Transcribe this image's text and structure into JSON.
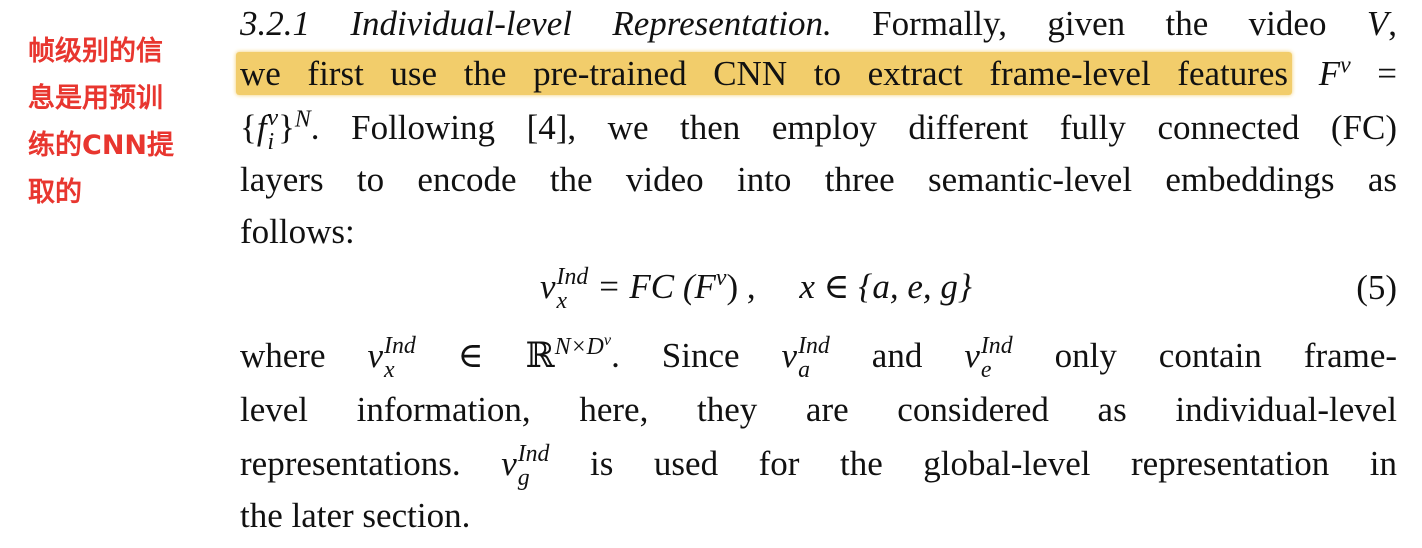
{
  "annotation": {
    "color": "#e8362f",
    "lines": [
      "帧级别的信",
      "息是用预训",
      "练的CNN提",
      "取的"
    ]
  },
  "highlight_color": "#f2cd6b",
  "section": {
    "number": "3.2.1",
    "title": "Individual-level Representation.",
    "line1_rest": "Formally, given the video",
    "video_sym": "V",
    "highlighted": "we first use the pre-trained CNN to extract frame-level features",
    "line2_rest": "= ",
    "F": "F",
    "v": "v",
    "f": "f",
    "i": "i",
    "N": "N",
    "line3_rest": ". Following [4], we then employ different fully connected (FC)",
    "line4": "layers to encode the video into three semantic-level embeddings as",
    "line5": "follows:",
    "equation": {
      "lhs_base": "v",
      "sup": "Ind",
      "sub_x": "x",
      "rhs": " = FC (F",
      "rhs_close": ") ,",
      "set": "x ∈ {a, e, g}",
      "number": "(5)"
    },
    "line7_a": "where",
    "line7_b": "∈ ℝ",
    "line7_sup": "N×D",
    "line7_c": ". Since",
    "line7_d": "and",
    "line7_e": "only contain frame-",
    "sub_a": "a",
    "sub_e": "e",
    "sub_g": "g",
    "line8": "level information, here, they are considered as individual-level",
    "line9_a": "representations.",
    "line9_b": "is used for the global-level representation in",
    "line10": "the later section."
  }
}
